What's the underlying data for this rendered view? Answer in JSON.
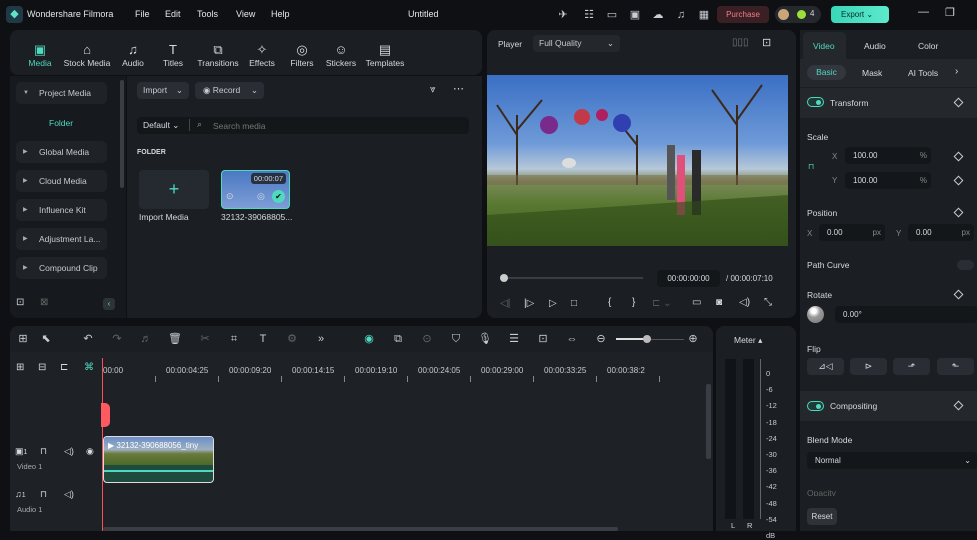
{
  "app": {
    "name": "Wondershare Filmora",
    "title": "Untitled",
    "menu": [
      "File",
      "Edit",
      "Tools",
      "View",
      "Help"
    ],
    "purchase_label": "Purchase",
    "credits": "4",
    "export_label": "Export"
  },
  "top_tabs": [
    {
      "label": "Media",
      "icon": "media-icon",
      "active": true
    },
    {
      "label": "Stock Media",
      "icon": "store-icon"
    },
    {
      "label": "Audio",
      "icon": "music-icon"
    },
    {
      "label": "Titles",
      "icon": "text-icon"
    },
    {
      "label": "Transitions",
      "icon": "transition-icon"
    },
    {
      "label": "Effects",
      "icon": "effects-icon"
    },
    {
      "label": "Filters",
      "icon": "filter-icon"
    },
    {
      "label": "Stickers",
      "icon": "sticker-icon"
    },
    {
      "label": "Templates",
      "icon": "template-icon"
    }
  ],
  "sidebar": {
    "items": [
      "Project Media",
      "Global Media",
      "Cloud Media",
      "Influence Kit",
      "Adjustment La...",
      "Compound Clip"
    ],
    "folder": "Folder"
  },
  "media": {
    "import_label": "Import",
    "record_label": "Record",
    "sort_label": "Default",
    "search_placeholder": "Search media",
    "section": "FOLDER",
    "import_media_label": "Import Media",
    "clip": {
      "name": "32132-39068805...",
      "duration": "00:00:07"
    }
  },
  "player": {
    "label": "Player",
    "quality": "Full Quality",
    "current_time": "00:00:00:00",
    "total_time": "/ 00:00:07:10",
    "progress": 0
  },
  "inspector": {
    "tabs": [
      "Video",
      "Audio",
      "Color"
    ],
    "subtabs": [
      "Basic",
      "Mask",
      "AI Tools"
    ],
    "transform": "Transform",
    "scale": "Scale",
    "scale_x": "100.00",
    "scale_y": "100.00",
    "percent": "%",
    "position": "Position",
    "pos_x": "0.00",
    "pos_y": "0.00",
    "px": "px",
    "x": "X",
    "y": "Y",
    "path_curve": "Path Curve",
    "rotate": "Rotate",
    "rotate_value": "0.00°",
    "flip": "Flip",
    "compositing": "Compositing",
    "blend_mode": "Blend Mode",
    "blend_value": "Normal",
    "opacity": "Opacity",
    "reset": "Reset"
  },
  "timeline": {
    "ruler": [
      "00:00",
      "00:00:04:25",
      "00:00:09:20",
      "00:00:14:15",
      "00:00:19:10",
      "00:00:24:05",
      "00:00:29:00",
      "00:00:33:25",
      "00:00:38:2"
    ],
    "video_track": {
      "label": "Video 1",
      "num": "1"
    },
    "audio_track": {
      "label": "Audio 1",
      "num": "1"
    },
    "clip_name": "32132-390688056_tiny",
    "zoom_level": 0.65
  },
  "meter": {
    "label": "Meter",
    "scale": [
      "0",
      "-6",
      "-12",
      "-18",
      "-24",
      "-30",
      "-36",
      "-42",
      "-48",
      "-54",
      "dB"
    ],
    "channels": [
      "L",
      "R"
    ]
  },
  "colors": {
    "accent": "#4fd9bf",
    "playhead": "#ff4d5a",
    "purchase": "#f07c8a"
  }
}
